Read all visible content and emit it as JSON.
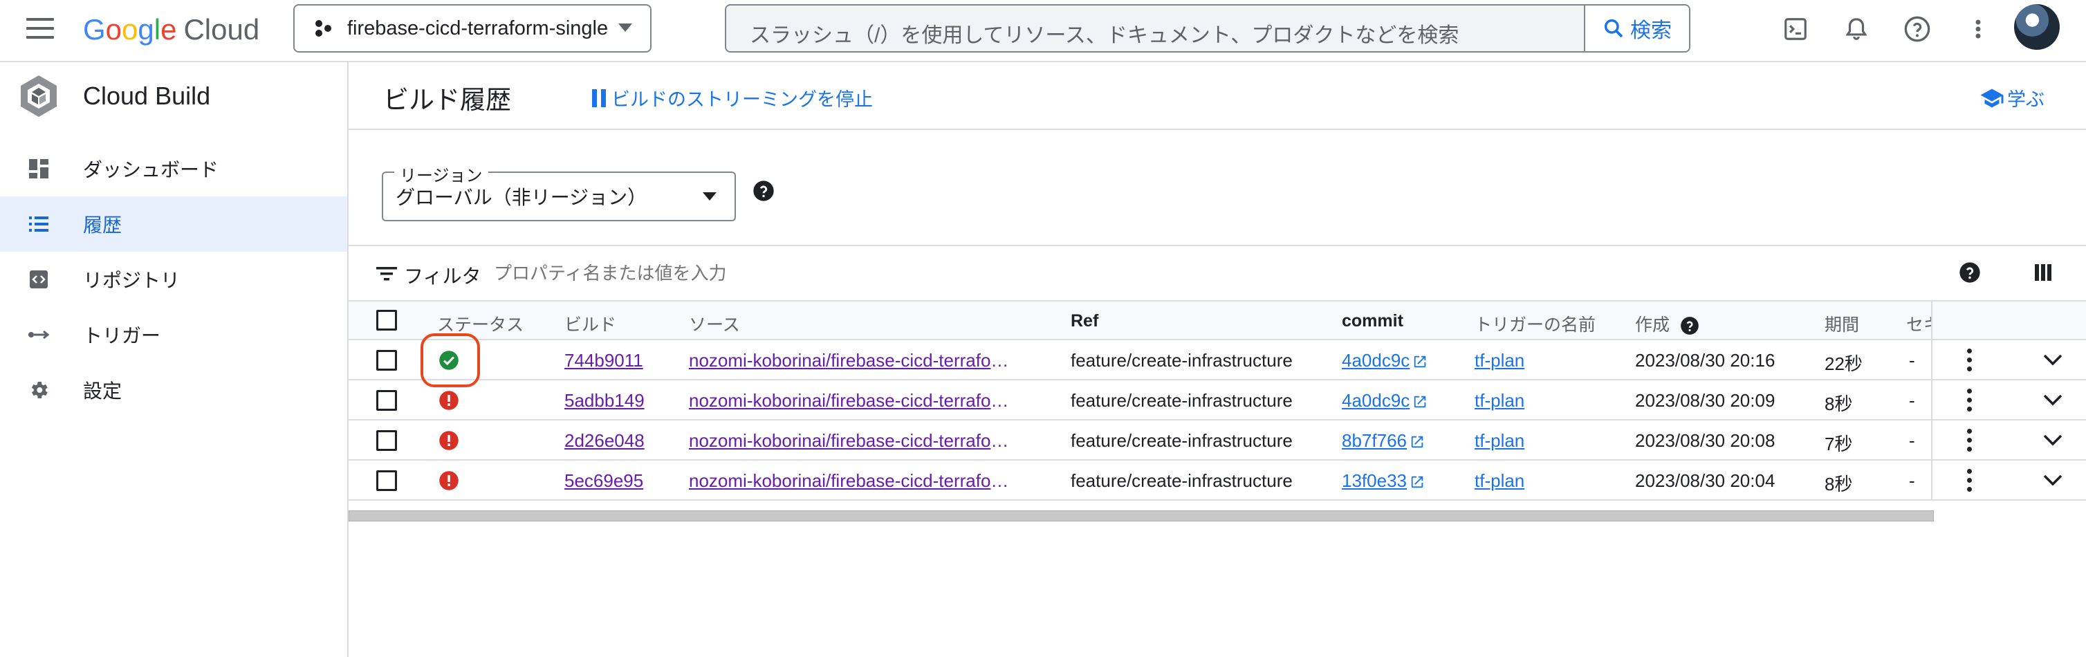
{
  "topbar": {
    "logo": {
      "google": "Google",
      "cloud": "Cloud"
    },
    "project_name": "firebase-cicd-terraform-single",
    "search_placeholder": "スラッシュ（/）を使用してリソース、ドキュメント、プロダクトなどを検索",
    "search_button": "検索"
  },
  "sidebar": {
    "product_name": "Cloud Build",
    "items": [
      {
        "label": "ダッシュボード",
        "icon": "dashboard-icon"
      },
      {
        "label": "履歴",
        "icon": "list-icon",
        "active": true
      },
      {
        "label": "リポジトリ",
        "icon": "repository-icon"
      },
      {
        "label": "トリガー",
        "icon": "trigger-icon"
      },
      {
        "label": "設定",
        "icon": "settings-icon"
      }
    ]
  },
  "main": {
    "title": "ビルド履歴",
    "stop_streaming": "ビルドのストリーミングを停止",
    "learn": "学ぶ"
  },
  "region": {
    "label": "リージョン",
    "value": "グローバル（非リージョン）"
  },
  "filter": {
    "label": "フィルタ",
    "placeholder": "プロパティ名または値を入力"
  },
  "table": {
    "headers": {
      "status": "ステータス",
      "build": "ビルド",
      "source": "ソース",
      "ref": "Ref",
      "commit": "commit",
      "trigger": "トリガーの名前",
      "created": "作成",
      "duration": "期間",
      "truncated": "セキ"
    },
    "rows": [
      {
        "status": "success",
        "build": "744b9011",
        "source": "nozomi-koborinai/firebase-cicd-terraform-single",
        "ref": "feature/create-infrastructure",
        "commit": "4a0dc9c",
        "trigger": "tf-plan",
        "created": "2023/08/30 20:16",
        "duration": "22秒",
        "extra": "-"
      },
      {
        "status": "failed",
        "build": "5adbb149",
        "source": "nozomi-koborinai/firebase-cicd-terraform-single",
        "ref": "feature/create-infrastructure",
        "commit": "4a0dc9c",
        "trigger": "tf-plan",
        "created": "2023/08/30 20:09",
        "duration": "8秒",
        "extra": "-"
      },
      {
        "status": "failed",
        "build": "2d26e048",
        "source": "nozomi-koborinai/firebase-cicd-terraform-single",
        "ref": "feature/create-infrastructure",
        "commit": "8b7f766",
        "trigger": "tf-plan",
        "created": "2023/08/30 20:08",
        "duration": "7秒",
        "extra": "-"
      },
      {
        "status": "failed",
        "build": "5ec69e95",
        "source": "nozomi-koborinai/firebase-cicd-terraform-single",
        "ref": "feature/create-infrastructure",
        "commit": "13f0e33",
        "trigger": "tf-plan",
        "created": "2023/08/30 20:04",
        "duration": "8秒",
        "extra": "-"
      }
    ]
  },
  "colors": {
    "accent": "#1a73e8",
    "success": "#1e8e3e",
    "error": "#d93025",
    "highlight_ring": "#e8461f",
    "visited_link": "#681da8"
  }
}
